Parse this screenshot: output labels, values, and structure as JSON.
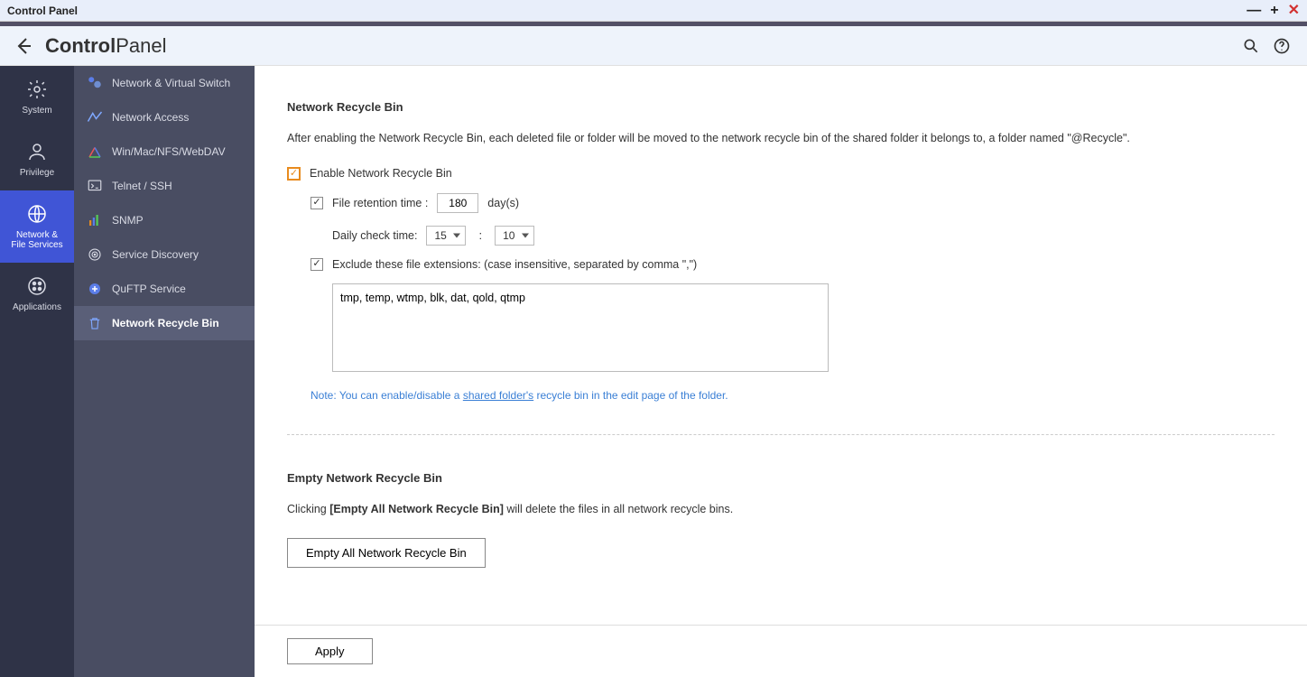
{
  "window": {
    "title": "Control Panel"
  },
  "app": {
    "title_bold": "Control",
    "title_light": "Panel"
  },
  "rail": [
    {
      "key": "system",
      "label": "System"
    },
    {
      "key": "privilege",
      "label": "Privilege"
    },
    {
      "key": "network-file-services",
      "label": "Network &\nFile Services",
      "active": true
    },
    {
      "key": "applications",
      "label": "Applications"
    }
  ],
  "subnav": [
    {
      "key": "network-virtual-switch",
      "label": "Network & Virtual Switch"
    },
    {
      "key": "network-access",
      "label": "Network Access"
    },
    {
      "key": "win-mac-nfs-webdav",
      "label": "Win/Mac/NFS/WebDAV"
    },
    {
      "key": "telnet-ssh",
      "label": "Telnet / SSH"
    },
    {
      "key": "snmp",
      "label": "SNMP"
    },
    {
      "key": "service-discovery",
      "label": "Service Discovery"
    },
    {
      "key": "quftp-service",
      "label": "QuFTP Service"
    },
    {
      "key": "network-recycle-bin",
      "label": "Network Recycle Bin",
      "active": true
    }
  ],
  "section1": {
    "title": "Network Recycle Bin",
    "desc": "After enabling the Network Recycle Bin, each deleted file or folder will be moved to the network recycle bin of the shared folder it belongs to, a folder named \"@Recycle\".",
    "enable_label": "Enable Network Recycle Bin",
    "retention_label": "File retention time :",
    "retention_value": "180",
    "retention_unit": "day(s)",
    "daily_check_label": "Daily check time:",
    "hour": "15",
    "minute": "10",
    "exclude_label": "Exclude these file extensions: (case insensitive, separated by comma \",\")",
    "exclude_value": "tmp, temp, wtmp, blk, dat, qold, qtmp",
    "note_prefix": "Note:",
    "note_text1": "You can enable/disable a ",
    "note_link": "shared folder's",
    "note_text2": " recycle bin in the edit page of the folder."
  },
  "section2": {
    "title": "Empty Network Recycle Bin",
    "desc_prefix": "Clicking ",
    "desc_bold": "[Empty All Network Recycle Bin]",
    "desc_suffix": " will delete the files in all network recycle bins.",
    "button": "Empty All Network Recycle Bin"
  },
  "footer": {
    "apply": "Apply"
  }
}
